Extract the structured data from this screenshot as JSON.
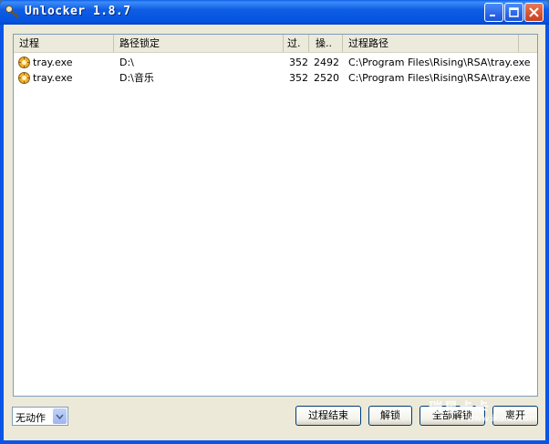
{
  "window": {
    "title": "Unlocker 1.8.7"
  },
  "columns": [
    "过程",
    "路径锁定",
    "过.",
    "操..",
    "过程路径"
  ],
  "rows": [
    {
      "process": "tray.exe",
      "locked_path": "D:\\",
      "pid": "352",
      "handle": "2492",
      "process_path": "C:\\Program Files\\Rising\\RSA\\tray.exe"
    },
    {
      "process": "tray.exe",
      "locked_path": "D:\\音乐",
      "pid": "352",
      "handle": "2520",
      "process_path": "C:\\Program Files\\Rising\\RSA\\tray.exe"
    }
  ],
  "action_select": {
    "value": "无动作"
  },
  "buttons": {
    "kill_process": "过程结束",
    "unlock": "解锁",
    "unlock_all": "全部解锁",
    "quit": "离开"
  },
  "watermark": {
    "domain": "www.ikaka.com",
    "logo_text": "瑞星卡卡"
  },
  "colors": {
    "titlebar": "#0a55e6",
    "face": "#ece9d8",
    "list_border": "#7f9db9"
  },
  "icons": {
    "app": "key-icon",
    "process": "process-gear-icon"
  }
}
